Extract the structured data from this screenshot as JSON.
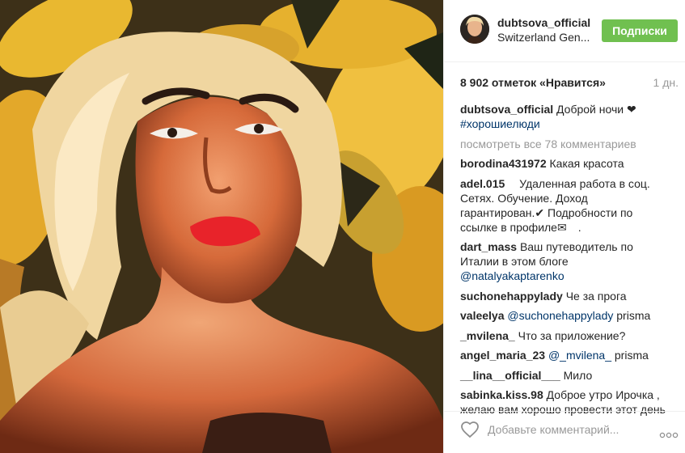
{
  "post": {
    "username": "dubtsova_official",
    "location": "Switzerland Gen...",
    "follow_label": "Подписки",
    "likes": "8 902 отметок «Нравится»",
    "time": "1 дн.",
    "caption_text": "Доброй ночи ❤",
    "caption_tag": "#хорошиелюди",
    "view_all": "посмотреть все 78 комментариев"
  },
  "comments": [
    {
      "user": "borodina431972",
      "text": "Какая красота"
    },
    {
      "user": "adel.015",
      "text": " Удаленная работа в соц. Сетях. Обучение. Доход гарантирован.✔ Подробности по ссылке в профиле✉ ."
    },
    {
      "user": "dart_mass",
      "text": "Ваш путеводитель по Италии в этом блоге",
      "mention": "@natalyakaptarenko"
    },
    {
      "user": "suchonehappylady",
      "text": "Че за прога"
    },
    {
      "user": "valeelya",
      "mention": "@suchonehappylady",
      "text": "prisma"
    },
    {
      "user": "_mvilena_",
      "text": "Что за приложение?"
    },
    {
      "user": "angel_maria_23",
      "mention": "@_mvilena_",
      "text": "prisma"
    },
    {
      "user": "__lina__official___",
      "text": "Мило  "
    },
    {
      "user": "sabinka.kiss.98",
      "text": "Доброе утро Ирочка , желаю вам хорошо провести этот день"
    }
  ],
  "footer": {
    "comment_placeholder": "Добавьте комментарий...",
    "like_icon": "heart-outline-icon",
    "more_icon": "more-options-icon"
  },
  "colors": {
    "follow_button": "#70c050",
    "link": "#003569",
    "muted": "#999999",
    "text": "#262626"
  }
}
